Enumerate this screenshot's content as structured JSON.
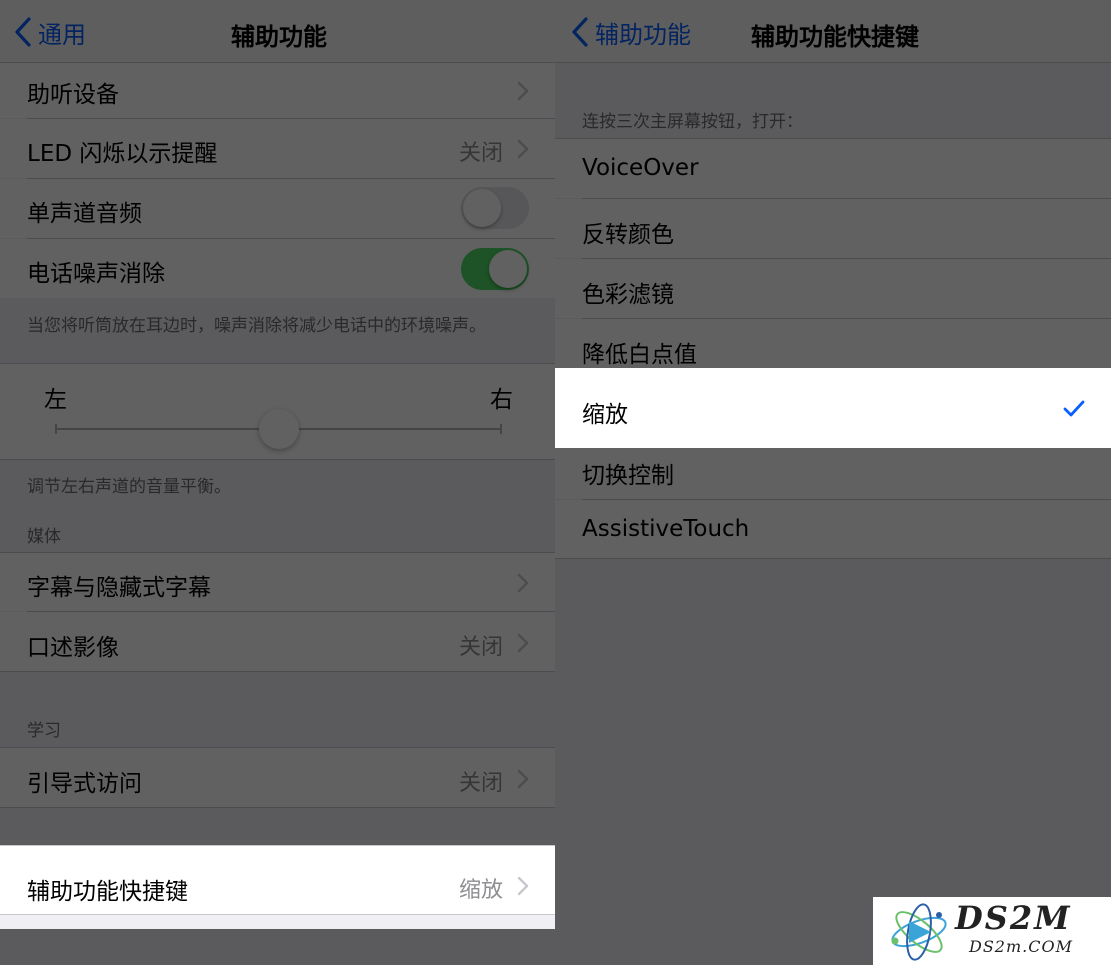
{
  "colors": {
    "accent": "#0a60fe",
    "switch_on": "#4cd964",
    "grouped_bg": "#efeff4"
  },
  "left": {
    "back_label": "通用",
    "title": "辅助功能",
    "rows": {
      "hearing_devices": {
        "label": "助听设备"
      },
      "led_flash": {
        "label": "LED 闪烁以示提醒",
        "value": "关闭"
      },
      "mono_audio": {
        "label": "单声道音频",
        "switch": "off"
      },
      "phone_noise": {
        "label": "电话噪声消除",
        "switch": "on"
      }
    },
    "noise_footer": "当您将听筒放在耳边时，噪声消除将减少电话中的环境噪声。",
    "balance": {
      "left_label": "左",
      "right_label": "右",
      "value": 0.5
    },
    "balance_footer": "调节左右声道的音量平衡。",
    "media_header": "媒体",
    "subtitles": {
      "label": "字幕与隐藏式字幕"
    },
    "audio_desc": {
      "label": "口述影像",
      "value": "关闭"
    },
    "learning_header": "学习",
    "guided_access": {
      "label": "引导式访问",
      "value": "关闭"
    },
    "shortcut": {
      "label": "辅助功能快捷键",
      "value": "缩放"
    }
  },
  "right": {
    "back_label": "辅助功能",
    "title": "辅助功能快捷键",
    "header": "连按三次主屏幕按钮，打开：",
    "options": [
      "VoiceOver",
      "反转颜色",
      "色彩滤镜",
      "降低白点值",
      "缩放",
      "切换控制",
      "AssistiveTouch"
    ],
    "selected": "缩放"
  },
  "watermark": {
    "text": "DS2M",
    "sub": "DS2m.COM"
  }
}
